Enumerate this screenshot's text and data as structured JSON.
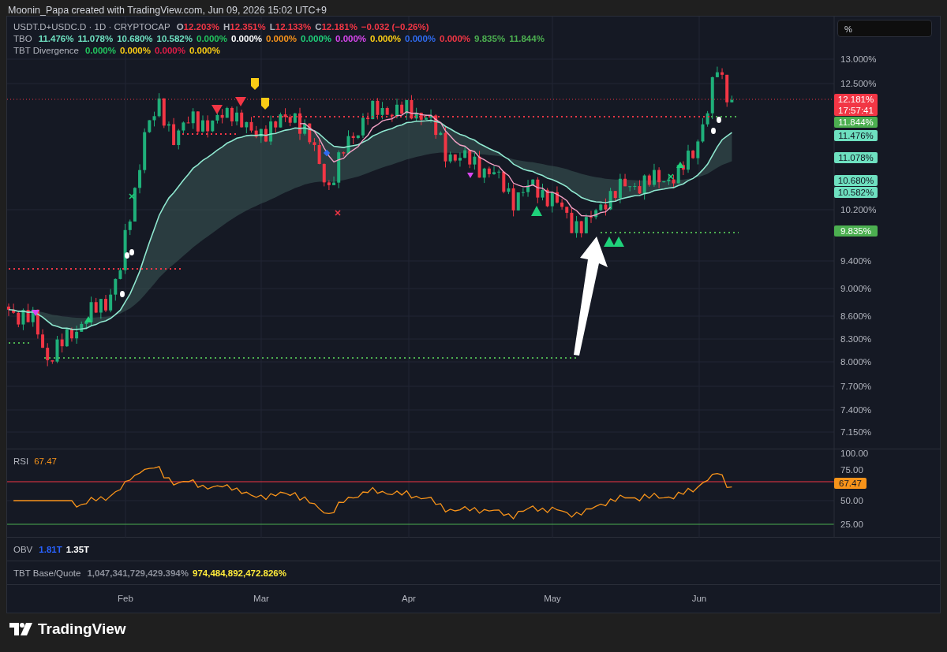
{
  "header": {
    "caption": "Moonin_Papa created with TradingView.com, Jun 09, 2026 15:02 UTC+9"
  },
  "scale_field": {
    "value": "%"
  },
  "legend": [
    {
      "name": "USDT.D+USDC.D · 1D · CRYPTOCAP",
      "values": [
        {
          "prefix": "O",
          "text": "12.203%",
          "color": "#f23645"
        },
        {
          "prefix": "H",
          "text": "12.351%",
          "color": "#f23645"
        },
        {
          "prefix": "L",
          "text": "12.133%",
          "color": "#f23645"
        },
        {
          "prefix": "C",
          "text": "12.181%",
          "color": "#f23645"
        },
        {
          "text": "−0.032 (−0.26%)",
          "color": "#f23645"
        }
      ]
    },
    {
      "name": "TBO",
      "values": [
        {
          "text": "11.476%",
          "color": "#6ee0c0"
        },
        {
          "text": "11.078%",
          "color": "#6ee0c0"
        },
        {
          "text": "10.680%",
          "color": "#6ee0c0"
        },
        {
          "text": "10.582%",
          "color": "#6ee0c0"
        },
        {
          "text": "0.000%",
          "color": "#22c55e"
        },
        {
          "text": "0.000%",
          "color": "#ffffff"
        },
        {
          "text": "0.000%",
          "color": "#f7931a"
        },
        {
          "text": "0.000%",
          "color": "#1fd17a"
        },
        {
          "text": "0.000%",
          "color": "#d946ef"
        },
        {
          "text": "0.000%",
          "color": "#facc15"
        },
        {
          "text": "0.000%",
          "color": "#2f6bf0"
        },
        {
          "text": "0.000%",
          "color": "#f23645"
        },
        {
          "text": "9.835%",
          "color": "#4caf50"
        },
        {
          "text": "11.844%",
          "color": "#4caf50"
        }
      ]
    },
    {
      "name": "TBT Divergence",
      "values": [
        {
          "text": "0.000%",
          "color": "#22c55e"
        },
        {
          "text": "0.000%",
          "color": "#facc15"
        },
        {
          "text": "0.000%",
          "color": "#e11d48"
        },
        {
          "text": "0.000%",
          "color": "#facc15"
        }
      ]
    }
  ],
  "price_axis": {
    "labels": [
      "13.000%",
      "12.500%",
      "10.200%",
      "9.400%",
      "9.000%",
      "8.600%",
      "8.300%",
      "8.000%",
      "7.700%",
      "7.400%",
      "7.150%"
    ]
  },
  "price_tags": [
    {
      "text": "12.181%",
      "subtext": "17:57:41",
      "color": "#f23645"
    },
    {
      "text": "11.844%",
      "color": "#4caf50"
    },
    {
      "text": "11.476%",
      "color": "#6ee0c0"
    },
    {
      "text": "11.078%",
      "color": "#6ee0c0"
    },
    {
      "text": "10.680%",
      "color": "#6ee0c0"
    },
    {
      "text": "10.582%",
      "color": "#6ee0c0"
    },
    {
      "text": "9.835%",
      "color": "#4caf50"
    }
  ],
  "rsi": {
    "label": "RSI",
    "value": "67.47",
    "axis_labels": [
      "100.00",
      "75.00",
      "50.00",
      "25.00"
    ],
    "tag": "67.47"
  },
  "obv": {
    "label": "OBV",
    "values": [
      {
        "text": "1.81T",
        "color": "#2962ff"
      },
      {
        "text": "1.35T",
        "color": "#ffffff"
      }
    ]
  },
  "base_quote": {
    "label": "TBT Base/Quote",
    "values": [
      {
        "text": "1,047,341,729,429.394%",
        "color": "#8a8e99"
      },
      {
        "text": "974,484,892,472.826%",
        "color": "#ffeb3b"
      }
    ]
  },
  "time_axis": [
    "Feb",
    "Mar",
    "Apr",
    "May",
    "Jun"
  ],
  "footer": {
    "logo_text": "TradingView"
  }
}
